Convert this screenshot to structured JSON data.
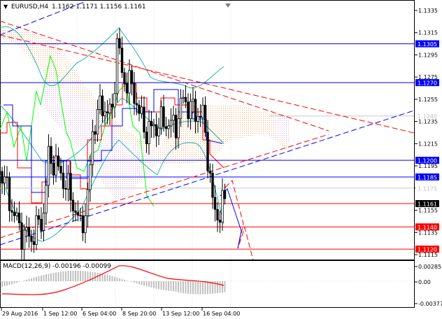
{
  "header": {
    "symbol_tf": "EURUSD,H4",
    "ohlc": "1.1162 1.1171 1.1156 1.1161"
  },
  "colors": {
    "background": "#ffffff",
    "grid": "#c8c8c8",
    "candle": "#000000",
    "support_resistance": "#0000ff",
    "red_line": "#ff0000",
    "trend_red": "#ff0000",
    "trend_blue": "#0000ff",
    "bollinger": "#20b2aa",
    "chikou": "#00ff00",
    "tenkan": "#ff0000",
    "kijun": "#0000ff",
    "cloud_a": "#f4a460",
    "cloud_b": "#dda0dd",
    "label_blue_bg": "#0000ff",
    "label_red_bg": "#ff0000",
    "label_gray": "#c0c0c0",
    "macd_hist": "#c0c0c0",
    "macd_signal": "#ff0000"
  },
  "price_axis": {
    "ticks": [
      "1.1335",
      "1.1315",
      "1.1295",
      "1.1275",
      "1.1255",
      "1.1235",
      "1.1215",
      "1.1195",
      "1.1175",
      "1.1155",
      "1.1135",
      "1.1115"
    ]
  },
  "price_tags": [
    {
      "text": "1.1305",
      "style": "blue"
    },
    {
      "text": "1.1270",
      "style": "blue"
    },
    {
      "text": "1.1240",
      "style": "gray"
    },
    {
      "text": "1.1200",
      "style": "blue"
    },
    {
      "text": "1.1185",
      "style": "blue"
    },
    {
      "text": "1.1175",
      "style": "gray"
    },
    {
      "text": "1.1161",
      "style": "current"
    },
    {
      "text": "1.1140",
      "style": "red"
    },
    {
      "text": "1.1120",
      "style": "red"
    }
  ],
  "macd": {
    "label": "MACD(12,26,9) -0.00196 -0.00099",
    "ticks": [
      "0.00285",
      "0.00",
      "-0.00377"
    ]
  },
  "time_axis": [
    "29 Aug 2016",
    "1 Sep 12:00",
    "6 Sep 04:00",
    "8 Sep 20:00",
    "13 Sep 12:00",
    "16 Sep 04:00"
  ],
  "chart_data": {
    "type": "candlestick",
    "symbol": "EURUSD",
    "timeframe": "H4",
    "ylim": [
      1.1108,
      1.1345
    ],
    "horizontal_levels": [
      {
        "price": 1.1305,
        "color": "blue"
      },
      {
        "price": 1.127,
        "color": "blue"
      },
      {
        "price": 1.12,
        "color": "blue"
      },
      {
        "price": 1.1185,
        "color": "blue"
      },
      {
        "price": 1.1161,
        "color": "red"
      },
      {
        "price": 1.114,
        "color": "red"
      },
      {
        "price": 1.112,
        "color": "red"
      }
    ],
    "macd_range": [
      -0.00377,
      0.00285
    ]
  }
}
